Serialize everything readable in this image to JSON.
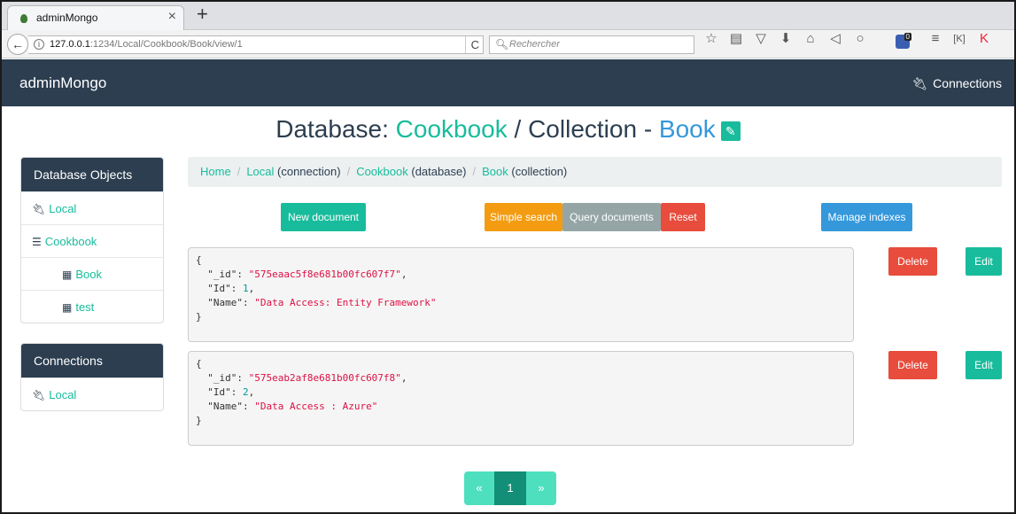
{
  "browser": {
    "tab_title": "adminMongo",
    "url_host": "127.0.0.1",
    "url_rest": ":1234/Local/Cookbook/Book/view/1",
    "search_placeholder": "Rechercher",
    "info_icon": "i",
    "reload_icon": "C",
    "new_tab": "+",
    "close_tab": "×",
    "back_icon": "←"
  },
  "app": {
    "brand": "adminMongo",
    "connections_link": "Connections"
  },
  "heading": {
    "prefix": "Database: ",
    "database": "Cookbook",
    "separator": " / Collection - ",
    "collection": "Book"
  },
  "sidebar": {
    "objects_header": "Database Objects",
    "objects_items": [
      {
        "label": "Local",
        "icon": "plug-icon"
      },
      {
        "label": "Cookbook",
        "icon": "database-icon"
      },
      {
        "label": "Book",
        "icon": "table-icon"
      },
      {
        "label": "test",
        "icon": "table-icon"
      }
    ],
    "connections_header": "Connections",
    "connections_items": [
      {
        "label": "Local",
        "icon": "plug-icon"
      }
    ]
  },
  "breadcrumb": {
    "home": "Home",
    "local": "Local",
    "local_type": "(connection)",
    "cookbook": "Cookbook",
    "cookbook_type": "(database)",
    "book": "Book",
    "book_type": "(collection)",
    "separator": "/"
  },
  "actions": {
    "new_document": "New document",
    "simple_search": "Simple search",
    "query_documents": "Query documents",
    "reset": "Reset",
    "manage_indexes": "Manage indexes",
    "delete": "Delete",
    "edit": "Edit"
  },
  "documents": [
    {
      "id": "575eaac5f8e681b00fc607f7",
      "Id": "1",
      "Name": "Data Access: Entity Framework"
    },
    {
      "id": "575eab2af8e681b00fc607f8",
      "Id": "2",
      "Name": "Data Access : Azure"
    }
  ],
  "pagination": {
    "prev": "«",
    "current": "1",
    "next": "»"
  },
  "colors": {
    "nav": "#2c3e50",
    "accent_green": "#18bc9c",
    "accent_blue": "#3498db",
    "danger": "#e74c3c",
    "warning": "#f39c12"
  }
}
